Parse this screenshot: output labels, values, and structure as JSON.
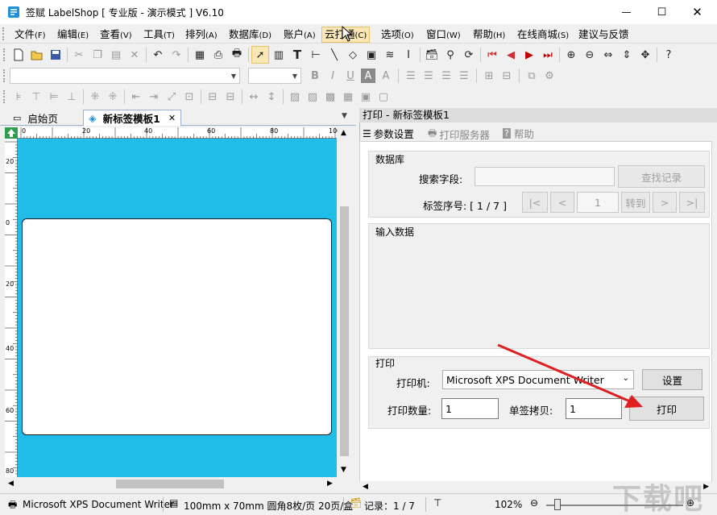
{
  "title": {
    "text": "签赋 LabelShop [ 专业版 - 演示模式 ]  V6.10",
    "min": "—",
    "max": "☐",
    "close": "✕"
  },
  "menu": [
    {
      "name": "文件",
      "acc": "(F)"
    },
    {
      "name": "编辑",
      "acc": "(E)"
    },
    {
      "name": "查看",
      "acc": "(V)"
    },
    {
      "name": "工具",
      "acc": "(T)"
    },
    {
      "name": "排列",
      "acc": "(A)"
    },
    {
      "name": "数据库",
      "acc": "(D)"
    },
    {
      "name": "账户",
      "acc": "(A)"
    },
    {
      "name": "云打通",
      "acc": "(C)"
    },
    {
      "name": "选项",
      "acc": "(O)"
    },
    {
      "name": "窗口",
      "acc": "(W)"
    },
    {
      "name": "帮助",
      "acc": "(H)"
    },
    {
      "name": "在线商城",
      "acc": "(S)"
    },
    {
      "name": "建议与反馈",
      "acc": ""
    }
  ],
  "toolbar2": {
    "bold": "B",
    "italic": "I",
    "underline": "U",
    "shade": "A",
    "fontcolor": "A"
  },
  "tabs": {
    "start": "启始页",
    "template": "新标签模板1",
    "close": "✕"
  },
  "rulers": {
    "top": [
      "0",
      "20",
      "40",
      "60",
      "80",
      "100"
    ],
    "left": [
      "0",
      "20",
      "0",
      "20",
      "40",
      "60",
      "80"
    ]
  },
  "panel": {
    "title": "打印 - 新标签模板1",
    "tools": {
      "params": "参数设置",
      "server": "打印服务器",
      "help": "帮助"
    },
    "db_group": "数据库",
    "search_label": "搜索字段:",
    "find_btn": "查找记录",
    "serial_label": "标签序号: [ 1 / 7 ]",
    "nav_first": "|<",
    "nav_prev": "<",
    "nav_value": "1",
    "nav_go": "转到",
    "nav_next": ">",
    "nav_last": ">|",
    "input_group": "输入数据",
    "print_group": "打印",
    "printer_label": "打印机:",
    "printer_value": "Microsoft XPS Document Writer",
    "setup_btn": "设置",
    "qty_label": "打印数量:",
    "qty_value": "1",
    "copies_label": "单签拷贝:",
    "copies_value": "1",
    "print_btn": "打印"
  },
  "status": {
    "printer": "Microsoft XPS Document Writer",
    "paper": "100mm x 70mm 圆角8枚/页 20页/盒",
    "record": "记录：1 / 7",
    "zoom": "102%"
  },
  "watermark": "下载吧",
  "colors": {
    "canvas": "#20bde8",
    "arrow": "#e02020",
    "menu_active": "#fbe7b5"
  }
}
